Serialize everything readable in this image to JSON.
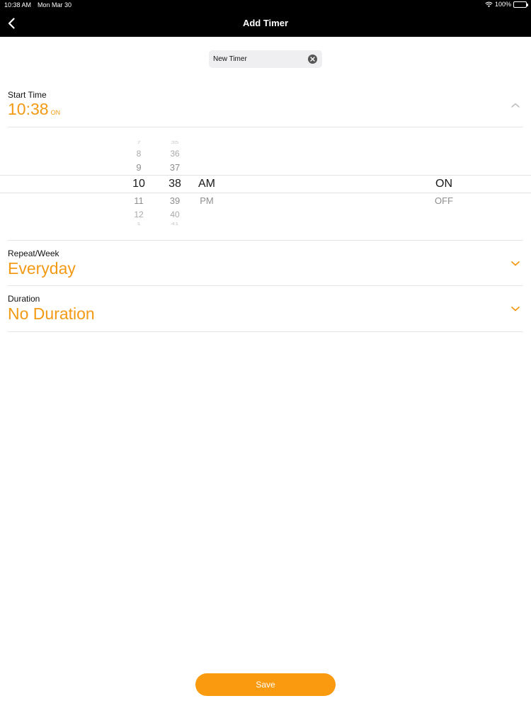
{
  "status_bar": {
    "time": "10:38 AM",
    "date": "Mon Mar 30",
    "battery": "100%"
  },
  "nav": {
    "title": "Add Timer"
  },
  "name_field": {
    "value": "New Timer"
  },
  "start_time": {
    "label": "Start Time",
    "value": "10:38",
    "state": "ON",
    "picker": {
      "hours": [
        "7",
        "8",
        "9",
        "10",
        "11",
        "12",
        "1"
      ],
      "minutes": [
        "35",
        "36",
        "37",
        "38",
        "39",
        "40",
        "41"
      ],
      "period": [
        "AM",
        "PM"
      ],
      "switch": [
        "ON",
        "OFF"
      ]
    }
  },
  "repeat": {
    "label": "Repeat/Week",
    "value": "Everyday"
  },
  "duration": {
    "label": "Duration",
    "value": "No Duration"
  },
  "save_label": "Save",
  "colors": {
    "accent": "#f39a14",
    "button": "#f99a0f",
    "header": "#000000"
  }
}
